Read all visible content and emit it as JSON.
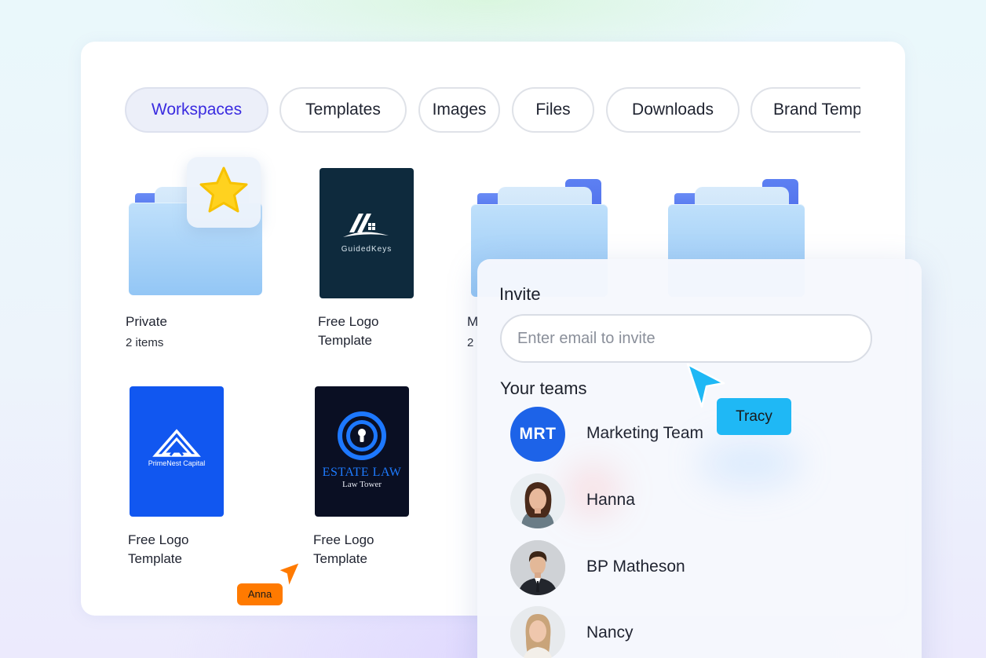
{
  "tabs": [
    {
      "label": "Workspaces",
      "active": true
    },
    {
      "label": "Templates",
      "active": false
    },
    {
      "label": "Images",
      "active": false
    },
    {
      "label": "Files",
      "active": false
    },
    {
      "label": "Downloads",
      "active": false
    },
    {
      "label": "Brand Templates",
      "active": false
    }
  ],
  "tiles": {
    "private": {
      "label": "Private",
      "count": "2 items"
    },
    "guidedkeys": {
      "line1": "Free Logo",
      "line2": "Template",
      "brand": "GuidedKeys"
    },
    "folder3": {
      "label": "M",
      "count": "2"
    },
    "primenest": {
      "line1": "Free Logo",
      "line2": "Template",
      "brand": "PrimeNest Capital"
    },
    "estatelaw": {
      "line1": "Free Logo",
      "line2": "Template",
      "brand": "ESTATE LAW",
      "tagline": "Law Tower"
    }
  },
  "invite": {
    "title": "Invite",
    "placeholder": "Enter email to invite",
    "teams_title": "Your teams"
  },
  "members": [
    {
      "name": "Marketing Team",
      "initials": "MRT",
      "avatar": "team-initials"
    },
    {
      "name": "Hanna",
      "avatar": "photo-hanna"
    },
    {
      "name": "BP Matheson",
      "avatar": "photo-bp-matheson"
    },
    {
      "name": "Nancy",
      "avatar": "photo-nancy"
    }
  ],
  "cursors": [
    {
      "name": "Tracy",
      "color": "#1fb8f5"
    },
    {
      "name": "Anna",
      "color": "#ff7a00"
    }
  ],
  "colors": {
    "accent": "#3a2be0",
    "folder_blue": "#5a7cf0",
    "mrt_blue": "#1d63e8",
    "star": "#ffd21f"
  }
}
